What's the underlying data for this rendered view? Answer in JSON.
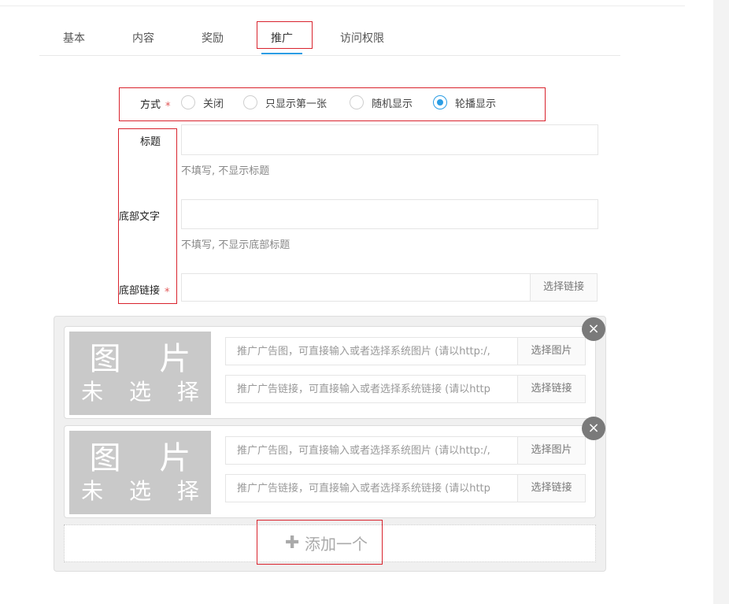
{
  "tabs": [
    {
      "label": "基本"
    },
    {
      "label": "内容"
    },
    {
      "label": "奖励"
    },
    {
      "label": "推广"
    },
    {
      "label": "访问权限"
    }
  ],
  "form": {
    "mode": {
      "label": "方式",
      "required_mark": "*",
      "options": [
        {
          "label": "关闭"
        },
        {
          "label": "只显示第一张"
        },
        {
          "label": "随机显示"
        },
        {
          "label": "轮播显示"
        }
      ],
      "selected": "轮播显示"
    },
    "title_field": {
      "label": "标题",
      "value": "",
      "help": "不填写, 不显示标题"
    },
    "footer_text": {
      "label": "底部文字",
      "value": "",
      "help": "不填写, 不显示底部标题"
    },
    "footer_link": {
      "label": "底部链接",
      "required_mark": "*",
      "value": "",
      "button_label": "选择链接"
    }
  },
  "ads": [
    {
      "image_text_line1": "图 片",
      "image_text_line2": "未 选 择",
      "image_placeholder": "推广广告图，可直接输入或者选择系统图片 (请以http:/,",
      "image_button": "选择图片",
      "link_placeholder": "推广广告链接，可直接输入或者选择系统链接 (请以http",
      "link_button": "选择链接",
      "close_glyph": "×"
    },
    {
      "image_text_line1": "图 片",
      "image_text_line2": "未 选 择",
      "image_placeholder": "推广广告图，可直接输入或者选择系统图片 (请以http:/,",
      "image_button": "选择图片",
      "link_placeholder": "推广广告链接，可直接输入或者选择系统链接 (请以http",
      "link_button": "选择链接",
      "close_glyph": "×"
    }
  ],
  "add_button": {
    "icon": "plus-icon",
    "label": "添加一个"
  },
  "colors": {
    "accent": "#2b9de4",
    "annotation_red": "#d9232d",
    "required": "#e05656",
    "placeholder_image": "#c9c9c9"
  }
}
